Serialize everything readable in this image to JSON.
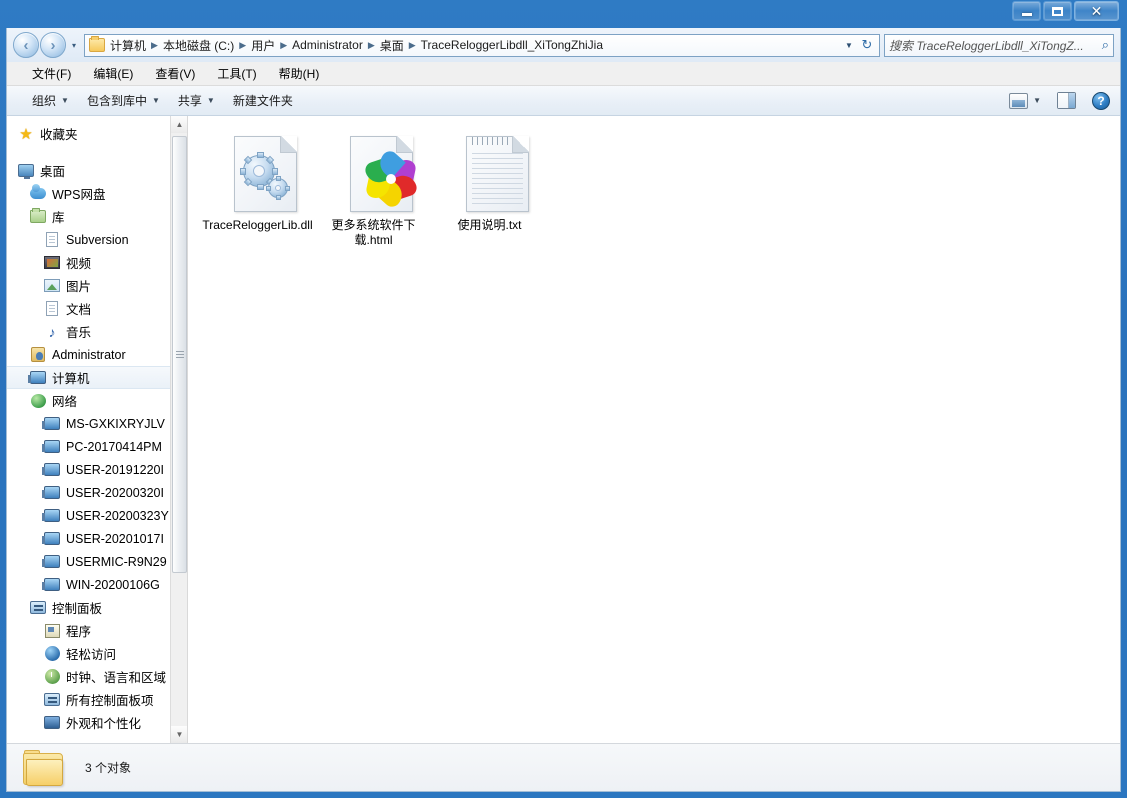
{
  "window": {
    "minimize_label": "最小化",
    "maximize_label": "最大化",
    "close_label": "关闭"
  },
  "nav": {
    "back_label": "后退",
    "forward_label": "前进",
    "recent_label": "最近浏览的位置",
    "breadcrumbs": [
      "计算机",
      "本地磁盘 (C:)",
      "用户",
      "Administrator",
      "桌面",
      "TraceReloggerLibdll_XiTongZhiJia"
    ],
    "dropdown_label": "▼",
    "refresh_label": "↻"
  },
  "search": {
    "text": "搜索 TraceReloggerLibdll_XiTongZ...",
    "icon": "search-icon"
  },
  "menubar": {
    "items": [
      {
        "label": "文件(F)"
      },
      {
        "label": "编辑(E)"
      },
      {
        "label": "查看(V)"
      },
      {
        "label": "工具(T)"
      },
      {
        "label": "帮助(H)"
      }
    ]
  },
  "toolbar": {
    "items": [
      {
        "label": "组织",
        "caret": "▼"
      },
      {
        "label": "包含到库中",
        "caret": "▼"
      },
      {
        "label": "共享",
        "caret": "▼"
      },
      {
        "label": "新建文件夹",
        "caret": ""
      }
    ],
    "views_caret": "▼",
    "views_label": "更改您的视图",
    "preview_label": "显示预览窗格",
    "help_label": "?"
  },
  "sidebar": {
    "items": [
      {
        "label": "收藏夹",
        "icon": "star-icon",
        "level": 0,
        "selected": false
      },
      {
        "label": "桌面",
        "icon": "desktop-icon",
        "level": 0,
        "selected": false
      },
      {
        "label": "WPS网盘",
        "icon": "cloud-icon",
        "level": 1,
        "selected": false
      },
      {
        "label": "库",
        "icon": "library-folder-icon",
        "level": 1,
        "selected": false
      },
      {
        "label": "Subversion",
        "icon": "subversion-icon",
        "level": 2,
        "selected": false
      },
      {
        "label": "视频",
        "icon": "video-icon",
        "level": 2,
        "selected": false
      },
      {
        "label": "图片",
        "icon": "picture-icon",
        "level": 2,
        "selected": false
      },
      {
        "label": "文档",
        "icon": "document-icon",
        "level": 2,
        "selected": false
      },
      {
        "label": "音乐",
        "icon": "music-icon",
        "level": 2,
        "selected": false
      },
      {
        "label": "Administrator",
        "icon": "user-icon",
        "level": 1,
        "selected": false
      },
      {
        "label": "计算机",
        "icon": "computer-icon",
        "level": 1,
        "selected": true
      },
      {
        "label": "网络",
        "icon": "network-icon",
        "level": 1,
        "selected": false
      },
      {
        "label": "MS-GXKIXRYJLV",
        "icon": "network-computer-icon",
        "level": 2,
        "selected": false
      },
      {
        "label": "PC-20170414PM",
        "icon": "network-computer-icon",
        "level": 2,
        "selected": false
      },
      {
        "label": "USER-20191220I",
        "icon": "network-computer-icon",
        "level": 2,
        "selected": false
      },
      {
        "label": "USER-20200320I",
        "icon": "network-computer-icon",
        "level": 2,
        "selected": false
      },
      {
        "label": "USER-20200323Y",
        "icon": "network-computer-icon",
        "level": 2,
        "selected": false
      },
      {
        "label": "USER-20201017I",
        "icon": "network-computer-icon",
        "level": 2,
        "selected": false
      },
      {
        "label": "USERMIC-R9N29",
        "icon": "network-computer-icon",
        "level": 2,
        "selected": false
      },
      {
        "label": "WIN-20200106G",
        "icon": "network-computer-icon",
        "level": 2,
        "selected": false
      },
      {
        "label": "控制面板",
        "icon": "control-panel-icon",
        "level": 1,
        "selected": false
      },
      {
        "label": "程序",
        "icon": "programs-icon",
        "level": 2,
        "selected": false
      },
      {
        "label": "轻松访问",
        "icon": "ease-of-access-icon",
        "level": 2,
        "selected": false
      },
      {
        "label": "时钟、语言和区域",
        "icon": "clock-language-region-icon",
        "level": 2,
        "selected": false
      },
      {
        "label": "所有控制面板项",
        "icon": "all-control-panel-items-icon",
        "level": 2,
        "selected": false
      },
      {
        "label": "外观和个性化",
        "icon": "appearance-personalization-icon",
        "level": 2,
        "selected": false
      }
    ],
    "scroll_up": "▲",
    "scroll_down": "▼"
  },
  "files": [
    {
      "name": "TraceReloggerLib.dll",
      "icon": "dll-gears-icon"
    },
    {
      "name": "更多系统软件下载.html",
      "icon": "html-pinwheel-icon"
    },
    {
      "name": "使用说明.txt",
      "icon": "text-file-icon"
    }
  ],
  "status": {
    "count_text": "3 个对象",
    "folder_icon": "folder-icon"
  },
  "colors": {
    "frame": "#2b76c0",
    "accent": "#2f6ca8",
    "selection": "#eaf1f8"
  }
}
